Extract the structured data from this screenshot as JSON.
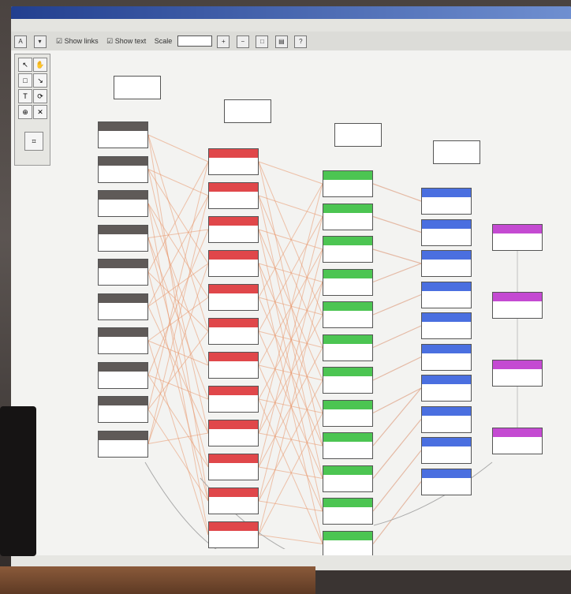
{
  "window": {
    "title": "",
    "status_text": ""
  },
  "menu": [],
  "toolbar": {
    "buttons": [
      "A"
    ],
    "show_links_label": "Show links",
    "show_text_label": "Show text",
    "scale_label": "Scale",
    "zoom_value": ""
  },
  "columns": [
    {
      "color": "#5f5a58",
      "class": "col-gray",
      "labels": [
        "",
        "",
        "",
        "",
        "",
        "",
        "",
        "",
        "",
        ""
      ]
    },
    {
      "color": "#e0474a",
      "class": "col-red",
      "labels": [
        "",
        "",
        "",
        "",
        "",
        "",
        "",
        "",
        "",
        "",
        "",
        ""
      ]
    },
    {
      "color": "#4cc552",
      "class": "col-green",
      "labels": [
        "",
        "",
        "",
        "",
        "",
        "",
        "",
        "",
        "",
        "",
        "",
        ""
      ]
    },
    {
      "color": "#4a6fe0",
      "class": "col-blue",
      "labels": [
        "",
        "",
        "",
        "",
        "",
        "",
        "",
        "",
        "",
        ""
      ]
    },
    {
      "color": "#c44ad2",
      "class": "col-purple",
      "labels": [
        "",
        "",
        "",
        ""
      ]
    }
  ]
}
